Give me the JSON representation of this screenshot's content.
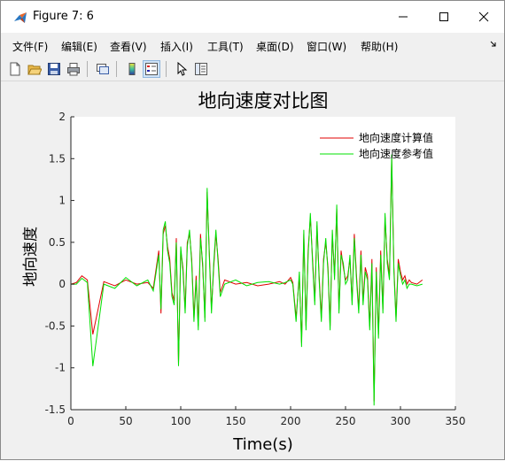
{
  "window": {
    "title": "Figure 7: 6",
    "controls": {
      "minimize": "minimize",
      "maximize": "maximize",
      "close": "close"
    }
  },
  "menubar": {
    "items": [
      "文件(F)",
      "编辑(E)",
      "查看(V)",
      "插入(I)",
      "工具(T)",
      "桌面(D)",
      "窗口(W)",
      "帮助(H)"
    ]
  },
  "toolbar": {
    "icons": [
      "new-figure-icon",
      "open-file-icon",
      "save-icon",
      "print-icon",
      "link-figure-icon",
      "colorbar-icon",
      "legend-icon",
      "pointer-icon",
      "property-editor-icon"
    ]
  },
  "chart_data": {
    "type": "line",
    "title": "地向速度对比图",
    "xlabel": "Time(s)",
    "ylabel": "地向速度",
    "xlim": [
      0,
      350
    ],
    "ylim": [
      -1.5,
      2
    ],
    "xticks": [
      "0",
      "50",
      "100",
      "150",
      "200",
      "250",
      "300",
      "350"
    ],
    "yticks": [
      "-1.5",
      "-1",
      "-0.5",
      "0",
      "0.5",
      "1",
      "1.5",
      "2"
    ],
    "grid": false,
    "legend_position": "top-right",
    "series": [
      {
        "name": "地向速度计算值",
        "color": "#e00000",
        "x": [
          0,
          5,
          10,
          15,
          20,
          30,
          40,
          50,
          60,
          70,
          75,
          80,
          82,
          84,
          86,
          88,
          90,
          92,
          94,
          96,
          98,
          100,
          102,
          104,
          106,
          108,
          110,
          112,
          114,
          116,
          118,
          120,
          122,
          124,
          126,
          128,
          130,
          132,
          134,
          136,
          140,
          150,
          160,
          170,
          180,
          190,
          195,
          200,
          202,
          205,
          208,
          210,
          212,
          214,
          216,
          218,
          220,
          222,
          224,
          226,
          228,
          230,
          232,
          234,
          236,
          238,
          240,
          242,
          244,
          246,
          248,
          250,
          252,
          254,
          256,
          258,
          260,
          262,
          264,
          266,
          268,
          270,
          272,
          274,
          276,
          278,
          280,
          282,
          284,
          286,
          288,
          290,
          292,
          294,
          296,
          298,
          300,
          302,
          304,
          306,
          308,
          310,
          315,
          320
        ],
        "y": [
          0,
          0.02,
          0.1,
          0.05,
          -0.6,
          0.03,
          -0.02,
          0.05,
          0,
          0.02,
          -0.05,
          0.4,
          -0.35,
          0.6,
          0.7,
          0.45,
          0.3,
          -0.1,
          -0.2,
          0.55,
          -0.95,
          0.4,
          0.2,
          -0.3,
          0.5,
          0.6,
          0.3,
          -0.4,
          0.1,
          -0.5,
          0.6,
          0.2,
          -0.4,
          1.1,
          0.4,
          -0.3,
          0.2,
          0.6,
          0.3,
          -0.1,
          0.05,
          0.0,
          0.02,
          -0.02,
          0.0,
          0.03,
          0.0,
          0.08,
          0.02,
          -0.4,
          0.1,
          -0.7,
          0.6,
          -0.5,
          0.4,
          0.8,
          0.3,
          -0.2,
          0.7,
          0.1,
          -0.4,
          0.3,
          0.5,
          0.2,
          -0.5,
          0.6,
          0.1,
          0.9,
          -0.3,
          0.4,
          0.2,
          0.05,
          0.1,
          0.3,
          -0.2,
          0.6,
          0.1,
          -0.3,
          0.4,
          -0.2,
          0.2,
          0.1,
          -0.5,
          0.3,
          -1.4,
          0.2,
          -0.6,
          0.4,
          -0.3,
          0.8,
          0.3,
          0.1,
          1.5,
          0.2,
          -0.4,
          0.3,
          0.15,
          0.05,
          0.1,
          0.0,
          0.05,
          0.02,
          0.0,
          0.05
        ]
      },
      {
        "name": "地向速度参考值",
        "color": "#00e000",
        "x": [
          0,
          5,
          10,
          15,
          20,
          30,
          40,
          50,
          60,
          70,
          75,
          80,
          82,
          84,
          86,
          88,
          90,
          92,
          94,
          96,
          98,
          100,
          102,
          104,
          106,
          108,
          110,
          112,
          114,
          116,
          118,
          120,
          122,
          124,
          126,
          128,
          130,
          132,
          134,
          136,
          140,
          150,
          160,
          170,
          180,
          190,
          195,
          200,
          202,
          205,
          208,
          210,
          212,
          214,
          216,
          218,
          220,
          222,
          224,
          226,
          228,
          230,
          232,
          234,
          236,
          238,
          240,
          242,
          244,
          246,
          248,
          250,
          252,
          254,
          256,
          258,
          260,
          262,
          264,
          266,
          268,
          270,
          272,
          274,
          276,
          278,
          280,
          282,
          284,
          286,
          288,
          290,
          292,
          294,
          296,
          298,
          300,
          302,
          304,
          306,
          308,
          310,
          315,
          320
        ],
        "y": [
          0,
          0.0,
          0.07,
          0.02,
          -0.98,
          0.0,
          -0.05,
          0.08,
          -0.02,
          0.05,
          -0.08,
          0.35,
          -0.3,
          0.65,
          0.75,
          0.4,
          0.25,
          -0.15,
          -0.25,
          0.5,
          -0.98,
          0.45,
          0.15,
          -0.35,
          0.45,
          0.65,
          0.25,
          -0.45,
          0.05,
          -0.55,
          0.55,
          0.25,
          -0.45,
          1.15,
          0.35,
          -0.35,
          0.25,
          0.65,
          0.25,
          -0.15,
          0.0,
          0.05,
          -0.02,
          0.02,
          0.03,
          0.0,
          0.02,
          0.05,
          0.0,
          -0.45,
          0.15,
          -0.75,
          0.65,
          -0.55,
          0.35,
          0.85,
          0.25,
          -0.25,
          0.75,
          0.05,
          -0.45,
          0.25,
          0.55,
          0.15,
          -0.55,
          0.65,
          0.05,
          0.95,
          -0.35,
          0.35,
          0.25,
          0.0,
          0.05,
          0.35,
          -0.25,
          0.55,
          0.05,
          -0.35,
          0.35,
          -0.25,
          0.15,
          0.05,
          -0.55,
          0.25,
          -1.45,
          0.15,
          -0.65,
          0.35,
          -0.35,
          0.85,
          0.25,
          0.05,
          1.55,
          0.15,
          -0.45,
          0.25,
          0.1,
          0.0,
          0.05,
          -0.05,
          0.0,
          0.0,
          -0.02,
          0.0
        ]
      }
    ]
  }
}
